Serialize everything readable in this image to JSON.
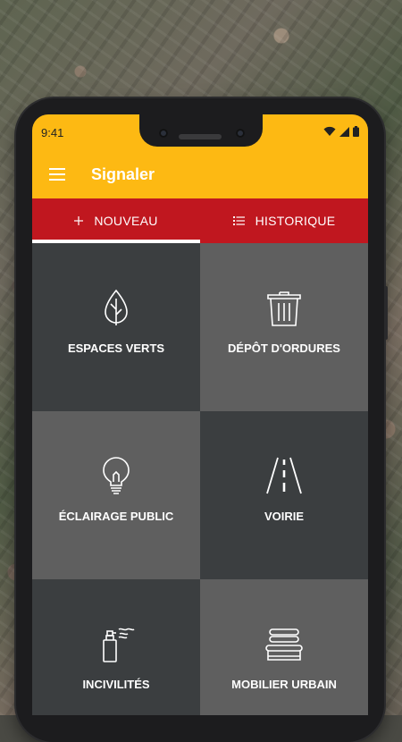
{
  "status": {
    "time": "9:41"
  },
  "appbar": {
    "title": "Signaler"
  },
  "tabs": [
    {
      "label": "NOUVEAU",
      "icon": "plus-icon",
      "active": true
    },
    {
      "label": "HISTORIQUE",
      "icon": "list-icon",
      "active": false
    }
  ],
  "categories": [
    {
      "label": "ESPACES VERTS",
      "icon": "tree-icon"
    },
    {
      "label": "DÉPÔT D'ORDURES",
      "icon": "trash-icon"
    },
    {
      "label": "ÉCLAIRAGE PUBLIC",
      "icon": "lightbulb-icon"
    },
    {
      "label": "VOIRIE",
      "icon": "road-icon"
    },
    {
      "label": "INCIVILITÉS",
      "icon": "spray-can-icon"
    },
    {
      "label": "MOBILIER URBAIN",
      "icon": "bench-icon"
    }
  ],
  "colors": {
    "primary": "#fdb913",
    "accent": "#c0171f",
    "tile_dark": "#3b3e40",
    "tile_light": "#5f5f5f"
  }
}
